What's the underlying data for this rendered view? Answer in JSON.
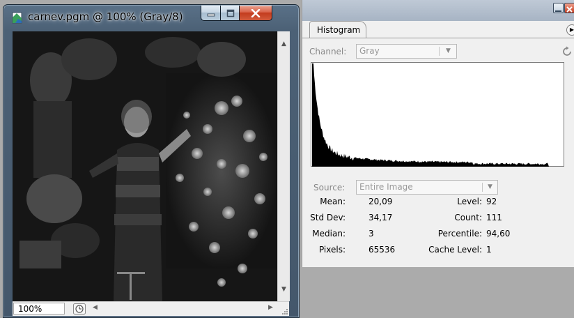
{
  "document_window": {
    "title": "carnev.pgm @ 100% (Gray/8)",
    "zoom": "100%",
    "app_icon": "photoshop-document-icon",
    "title_buttons": [
      "minimize-icon",
      "maximize-icon",
      "close-icon"
    ]
  },
  "histogram_panel": {
    "tab_label": "Histogram",
    "channel_label": "Channel:",
    "channel_value": "Gray",
    "source_label": "Source:",
    "source_value": "Entire Image",
    "colors": {
      "histogram_fill": "#000000",
      "panel_bg": "#f0f0f0",
      "titlebar": "#a7b4c4"
    },
    "stats_left": [
      {
        "label": "Mean:",
        "value": "20,09"
      },
      {
        "label": "Std Dev:",
        "value": "34,17"
      },
      {
        "label": "Median:",
        "value": "3"
      },
      {
        "label": "Pixels:",
        "value": "65536"
      }
    ],
    "stats_right": [
      {
        "label": "Level:",
        "value": "92"
      },
      {
        "label": "Count:",
        "value": "111"
      },
      {
        "label": "Percentile:",
        "value": "94,60"
      },
      {
        "label": "Cache Level:",
        "value": "1"
      }
    ]
  }
}
